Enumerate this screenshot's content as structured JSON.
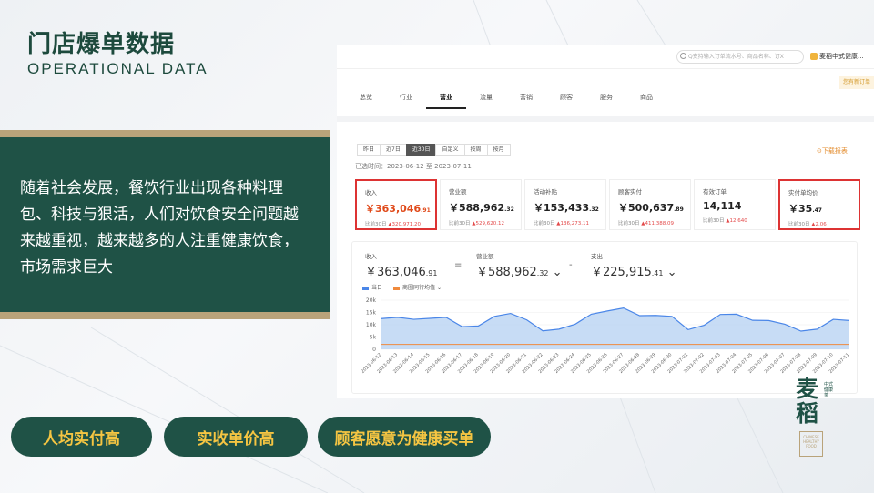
{
  "slide": {
    "title_cn": "门店爆单数据",
    "title_en": "OPERATIONAL DATA",
    "body": "随着社会发展，餐饮行业出现各种料理包、科技与狠活，人们对饮食安全问题越来越重视，越来越多的人注重健康饮食，市场需求巨大",
    "pills": [
      "人均实付高",
      "实收单价高",
      "顾客愿意为健康买单"
    ],
    "colors": {
      "primary_green": "#1f5246",
      "gold": "#b9a37a",
      "pill_text": "#f5c542"
    }
  },
  "logo": {
    "name": "麦稻",
    "side_text": "中式健康茶",
    "en": "CHINESE HEALTHY FOOD"
  },
  "dashboard": {
    "search_placeholder": "Q支持输入订单流水号、商品名称、订X",
    "user": "麦稻中式健康...",
    "notice": "您有新订单",
    "tabs": [
      "总览",
      "行业",
      "营业",
      "流量",
      "营销",
      "顾客",
      "服务",
      "商品"
    ],
    "active_tab": "营业",
    "range_buttons": [
      "昨日",
      "近7日",
      "近30日",
      "自定义",
      "按周",
      "按月"
    ],
    "active_range": "近30日",
    "download": "下载报表",
    "period": "已选时间：2023-06-12 至 2023-07-11",
    "cards": [
      {
        "label": "收入",
        "value": "￥363,046",
        "decimals": ".91",
        "compare": "比前30日",
        "delta": "320,971.20",
        "highlight": true
      },
      {
        "label": "营业额",
        "value": "￥588,962",
        "decimals": ".32",
        "compare": "比前30日",
        "delta": "529,620.12",
        "highlight": false
      },
      {
        "label": "活动补贴",
        "value": "￥153,433",
        "decimals": ".32",
        "compare": "比前30日",
        "delta": "136,273.11",
        "highlight": false
      },
      {
        "label": "顾客实付",
        "value": "￥500,637",
        "decimals": ".89",
        "compare": "比前30日",
        "delta": "411,388.09",
        "highlight": false
      },
      {
        "label": "有效订单",
        "value": "14,114",
        "decimals": "",
        "compare": "比前30日",
        "delta": "12,640",
        "highlight": false
      },
      {
        "label": "实付单均价",
        "value": "￥35",
        "decimals": ".47",
        "compare": "比前30日",
        "delta": "2.06",
        "highlight": true
      }
    ],
    "metrics": [
      {
        "label": "收入",
        "value": "￥363,046",
        "decimals": ".91"
      },
      {
        "label": "营业额",
        "value": "￥588,962",
        "decimals": ".32"
      },
      {
        "label": "支出",
        "value": "￥225,915",
        "decimals": ".41"
      }
    ],
    "operators": [
      "=",
      "-"
    ],
    "legend": [
      "当日",
      "商圈同行均值"
    ]
  },
  "chart_data": {
    "type": "area",
    "x": [
      "2023-06-12",
      "2023-06-13",
      "2023-06-14",
      "2023-06-15",
      "2023-06-16",
      "2023-06-17",
      "2023-06-18",
      "2023-06-19",
      "2023-06-20",
      "2023-06-21",
      "2023-06-22",
      "2023-06-23",
      "2023-06-24",
      "2023-06-25",
      "2023-06-26",
      "2023-06-27",
      "2023-06-28",
      "2023-06-29",
      "2023-06-30",
      "2023-07-01",
      "2023-07-02",
      "2023-07-03",
      "2023-07-04",
      "2023-07-05",
      "2023-07-06",
      "2023-07-07",
      "2023-07-08",
      "2023-07-09",
      "2023-07-10",
      "2023-07-11"
    ],
    "series": [
      {
        "name": "当日",
        "values": [
          12500,
          13000,
          12200,
          12600,
          13000,
          9200,
          9500,
          13400,
          14600,
          12000,
          7500,
          8200,
          10200,
          14300,
          15600,
          16800,
          13700,
          13800,
          13400,
          8000,
          9800,
          14200,
          14300,
          11800,
          11700,
          10200,
          7400,
          8200,
          12200,
          11700
        ],
        "color": "#4a86e8"
      },
      {
        "name": "商圈同行均值",
        "values": [
          2000,
          2000,
          2000,
          2000,
          2000,
          2000,
          2000,
          2000,
          2000,
          2000,
          2000,
          2000,
          2000,
          2000,
          2000,
          2000,
          2000,
          2000,
          2000,
          2000,
          2000,
          2000,
          2000,
          2000,
          2000,
          2000,
          2000,
          2000,
          2000,
          2000
        ],
        "color": "#f08a3c"
      }
    ],
    "yticks": [
      "20k",
      "15k",
      "10k",
      "5k",
      "0"
    ],
    "ylim": [
      0,
      20000
    ],
    "grid": true,
    "legend_position": "top-left"
  }
}
